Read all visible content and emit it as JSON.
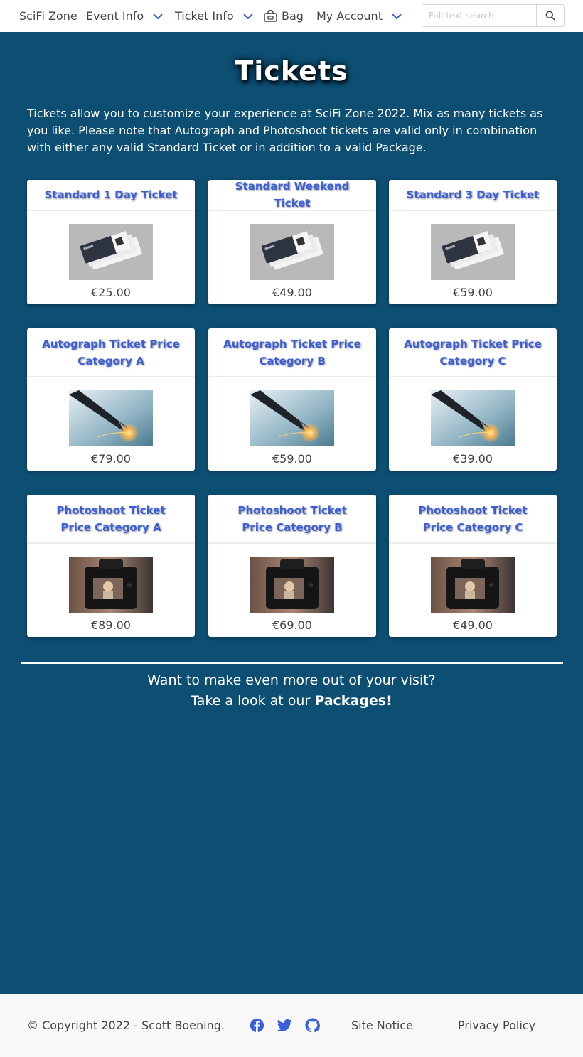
{
  "navbar": {
    "brand": "SciFi Zone",
    "event_info": "Event Info",
    "ticket_info": "Ticket Info",
    "bag": "Bag",
    "my_account": "My Account",
    "search_placeholder": "Full text search"
  },
  "hero": {
    "title": "Tickets",
    "intro": "Tickets allow you to customize your experience at SciFi Zone 2022. Mix as many tickets as you like. Please note that Autograph and Photoshoot tickets are valid only in combination with either any valid Standard Ticket or in addition to a valid Package."
  },
  "tickets": [
    {
      "name": "Standard 1 Day Ticket",
      "price": "€25.00",
      "image": "ticket-image"
    },
    {
      "name": "Standard Weekend Ticket",
      "price": "€49.00",
      "image": "ticket-image"
    },
    {
      "name": "Standard 3 Day Ticket",
      "price": "€59.00",
      "image": "ticket-image"
    },
    {
      "name": "Autograph Ticket Price Category A",
      "price": "€79.00",
      "image": "pen-image"
    },
    {
      "name": "Autograph Ticket Price Category B",
      "price": "€59.00",
      "image": "pen-image"
    },
    {
      "name": "Autograph Ticket Price Category C",
      "price": "€39.00",
      "image": "pen-image"
    },
    {
      "name": "Photoshoot Ticket Price Category A",
      "price": "€89.00",
      "image": "camera-image"
    },
    {
      "name": "Photoshoot Ticket Price Category B",
      "price": "€69.00",
      "image": "camera-image"
    },
    {
      "name": "Photoshoot Ticket Price Category C",
      "price": "€49.00",
      "image": "camera-image"
    }
  ],
  "cta": {
    "line1": "Want to make even more out of your visit?",
    "line2_prefix": "Take a look at our ",
    "line2_link": "Packages!"
  },
  "footer": {
    "copyright": "© Copyright 2022 - Scott Boening.",
    "social_icons": [
      "facebook-icon",
      "twitter-icon",
      "github-icon"
    ],
    "site_notice": "Site Notice",
    "privacy_policy": "Privacy Policy"
  },
  "colors": {
    "background": "#0d4e73",
    "accent": "#3a5fd8",
    "card_text": "#444444"
  }
}
